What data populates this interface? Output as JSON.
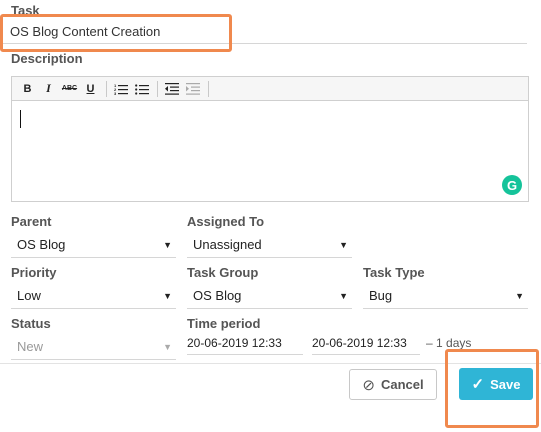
{
  "task": {
    "label": "Task",
    "value": "OS Blog Content Creation"
  },
  "description": {
    "label": "Description",
    "toolbar": {
      "bold": "B",
      "italic": "I",
      "strike": "ABC",
      "underline": "U"
    },
    "grammarly": "G"
  },
  "parent": {
    "label": "Parent",
    "value": "OS Blog"
  },
  "assigned_to": {
    "label": "Assigned To",
    "value": "Unassigned"
  },
  "priority": {
    "label": "Priority",
    "value": "Low"
  },
  "task_group": {
    "label": "Task Group",
    "value": "OS Blog"
  },
  "task_type": {
    "label": "Task Type",
    "value": "Bug"
  },
  "status": {
    "label": "Status",
    "value": "New"
  },
  "time_period": {
    "label": "Time period",
    "start": "20-06-2019 12:33",
    "end": "20-06-2019 12:33",
    "duration": "– 1 days"
  },
  "caret_glyph": "▼",
  "buttons": {
    "cancel": "Cancel",
    "save": "Save",
    "cancel_icon": "⊘",
    "save_icon": "✓"
  },
  "colors": {
    "highlight": "#f0894e",
    "save_bg": "#2fb5d6",
    "grammarly": "#15c39a"
  }
}
